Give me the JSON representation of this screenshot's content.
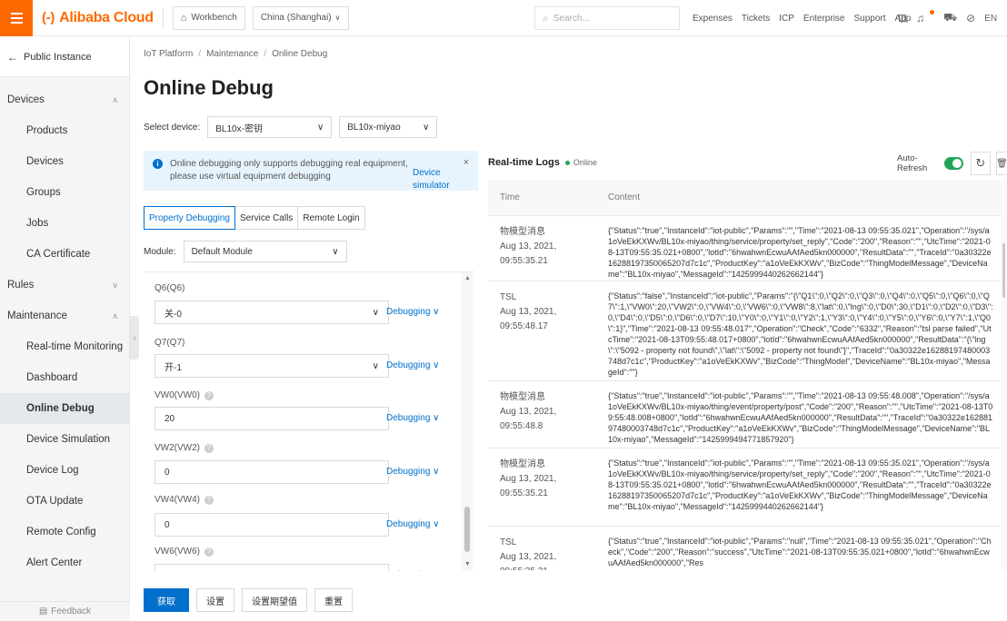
{
  "topbar": {
    "logo_mark": "(-)",
    "logo_text": "Alibaba Cloud",
    "workbench": "Workbench",
    "region": "China (Shanghai)",
    "search_placeholder": "Search...",
    "links": [
      "Expenses",
      "Tickets",
      "ICP",
      "Enterprise",
      "Support",
      "App"
    ],
    "lang": "EN"
  },
  "sidebar": {
    "back": "Public Instance",
    "groups": {
      "devices": "Devices",
      "rules": "Rules",
      "maintenance": "Maintenance"
    },
    "devices_items": [
      "Products",
      "Devices",
      "Groups",
      "Jobs",
      "CA Certificate"
    ],
    "maintenance_items": [
      "Real-time Monitoring",
      "Dashboard",
      "Online Debug",
      "Device Simulation",
      "Device Log",
      "OTA Update",
      "Remote Config",
      "Alert Center"
    ],
    "feedback": "Feedback"
  },
  "breadcrumb": [
    "IoT Platform",
    "Maintenance",
    "Online Debug"
  ],
  "page_title": "Online Debug",
  "select_device": {
    "label": "Select device:",
    "product": "BL10x-密钥",
    "device": "BL10x-miyao"
  },
  "notice": {
    "text": "Online debugging only supports debugging real equipment, please use virtual equipment debugging",
    "link": "Device simulator"
  },
  "tabs": [
    "Property Debugging",
    "Service Calls",
    "Remote Login"
  ],
  "module": {
    "label": "Module:",
    "value": "Default Module"
  },
  "properties": [
    {
      "label": "Q6(Q6)",
      "value": "关-0",
      "type": "select"
    },
    {
      "label": "Q7(Q7)",
      "value": "开-1",
      "type": "select"
    },
    {
      "label": "VW0(VW0)",
      "value": "20",
      "type": "input"
    },
    {
      "label": "VW2(VW2)",
      "value": "0",
      "type": "input"
    },
    {
      "label": "VW4(VW4)",
      "value": "0",
      "type": "input"
    },
    {
      "label": "VW6(VW6)",
      "value": "0",
      "type": "input"
    }
  ],
  "debugging_label": "Debugging",
  "actions": [
    "获取",
    "设置",
    "设置期望值",
    "重置"
  ],
  "logs": {
    "title": "Real-time Logs",
    "status": "Online",
    "auto_refresh": "Auto-Refresh",
    "col_time": "Time",
    "col_content": "Content",
    "rows": [
      {
        "type": "物模型消息",
        "time": "Aug 13, 2021, 09:55:35.21",
        "content": "{\"Status\":\"true\",\"InstanceId\":\"iot-public\",\"Params\":\"\",\"Time\":\"2021-08-13 09:55:35.021\",\"Operation\":\"/sys/a1oVeEkKXWv/BL10x-miyao/thing/service/property/set_reply\",\"Code\":\"200\",\"Reason\":\"\",\"UtcTime\":\"2021-08-13T09:55:35.021+0800\",\"lotId\":\"6hwahwnEcwuAAfAed5kn000000\",\"ResultData\":\"\",\"TraceId\":\"0a30322e16288197350065207d7c1c\",\"ProductKey\":\"a1oVeEkKXWv\",\"BizCode\":\"ThingModelMessage\",\"DeviceName\":\"BL10x-miyao\",\"MessageId\":\"1425999440262662144\"}"
      },
      {
        "type": "TSL",
        "time": "Aug 13, 2021, 09:55:48.17",
        "content": "{\"Status\":\"false\",\"InstanceId\":\"iot-public\",\"Params\":\"{\\\"Q1\\\":0,\\\"Q2\\\":0,\\\"Q3\\\":0,\\\"Q4\\\":0,\\\"Q5\\\":0,\\\"Q6\\\":0,\\\"Q7\\\":1,\\\"VW0\\\":20,\\\"VW2\\\":0,\\\"VW4\\\":0,\\\"VW6\\\":0,\\\"VW8\\\":8,\\\"lat\\\":0,\\\"lng\\\":0,\\\"D0\\\":30,\\\"D1\\\":0,\\\"D2\\\":0,\\\"D3\\\":0,\\\"D4\\\":0,\\\"D5\\\":0,\\\"D6\\\":0,\\\"D7\\\":10,\\\"Y0\\\":0,\\\"Y1\\\":0,\\\"Y2\\\":1,\\\"Y3\\\":0,\\\"Y4\\\":0,\\\"Y5\\\":0,\\\"Y6\\\":0,\\\"Y7\\\":1,\\\"Q0\\\":1}\",\"Time\":\"2021-08-13 09:55:48.017\",\"Operation\":\"Check\",\"Code\":\"6332\",\"Reason\":\"tsl parse failed\",\"UtcTime\":\"2021-08-13T09:55:48.017+0800\",\"lotId\":\"6hwahwnEcwuAAfAed5kn000000\",\"ResultData\":\"{\\\"lng\\\":\\\"5092 - property not found\\\",\\\"lat\\\":\\\"5092 - property not found\\\"}\",\"TraceId\":\"0a30322e16288197480003748d7c1c\",\"ProductKey\":\"a1oVeEkKXWv\",\"BizCode\":\"ThingModel\",\"DeviceName\":\"BL10x-miyao\",\"MessageId\":\"\"}"
      },
      {
        "type": "物模型消息",
        "time": "Aug 13, 2021, 09:55:48.8",
        "content": "{\"Status\":\"true\",\"InstanceId\":\"iot-public\",\"Params\":\"\",\"Time\":\"2021-08-13 09:55:48.008\",\"Operation\":\"/sys/a1oVeEkKXWv/BL10x-miyao/thing/event/property/post\",\"Code\":\"200\",\"Reason\":\"\",\"UtcTime\":\"2021-08-13T09:55:48.008+0800\",\"lotId\":\"6hwahwnEcwuAAfAed5kn000000\",\"ResultData\":\"\",\"TraceId\":\"0a30322e16288197480003748d7c1c\",\"ProductKey\":\"a1oVeEkKXWv\",\"BizCode\":\"ThingModelMessage\",\"DeviceName\":\"BL10x-miyao\",\"MessageId\":\"1425999494771857920\"}"
      },
      {
        "type": "物模型消息",
        "time": "Aug 13, 2021, 09:55:35.21",
        "content": "{\"Status\":\"true\",\"InstanceId\":\"iot-public\",\"Params\":\"\",\"Time\":\"2021-08-13 09:55:35.021\",\"Operation\":\"/sys/a1oVeEkKXWv/BL10x-miyao/thing/service/property/set_reply\",\"Code\":\"200\",\"Reason\":\"\",\"UtcTime\":\"2021-08-13T09:55:35.021+0800\",\"lotId\":\"6hwahwnEcwuAAfAed5kn000000\",\"ResultData\":\"\",\"TraceId\":\"0a30322e16288197350065207d7c1c\",\"ProductKey\":\"a1oVeEkKXWv\",\"BizCode\":\"ThingModelMessage\",\"DeviceName\":\"BL10x-miyao\",\"MessageId\":\"1425999440262662144\"}"
      },
      {
        "type": "TSL",
        "time": "Aug 13, 2021, 09:55:35.21",
        "content": "{\"Status\":\"true\",\"InstanceId\":\"iot-public\",\"Params\":\"null\",\"Time\":\"2021-08-13 09:55:35.021\",\"Operation\":\"Check\",\"Code\":\"200\",\"Reason\":\"success\",\"UtcTime\":\"2021-08-13T09:55:35.021+0800\",\"lotId\":\"6hwahwnEcwuAAfAed5kn000000\",\"Res"
      }
    ]
  },
  "colors": {
    "brand": "#ff6a00",
    "primary": "#0070cc",
    "online": "#1fa65a"
  }
}
